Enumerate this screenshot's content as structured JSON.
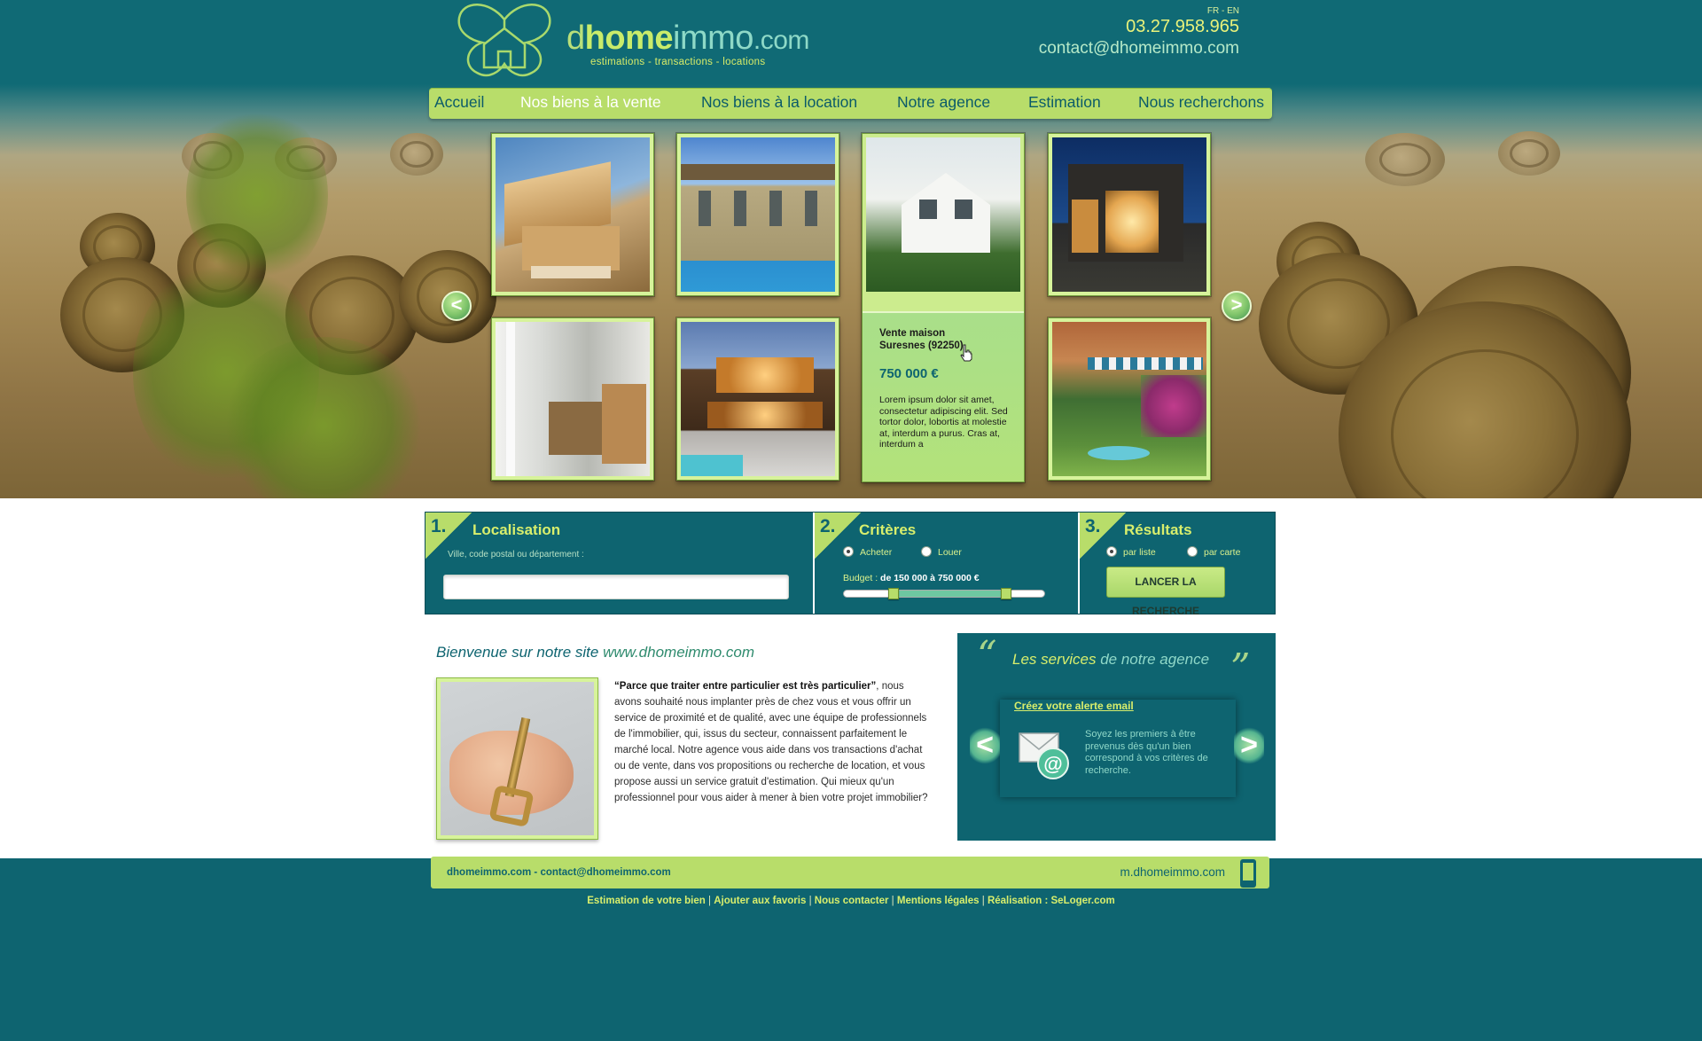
{
  "header": {
    "brand_d": "d",
    "brand_home": "home",
    "brand_immo": "immo",
    "brand_com": ".com",
    "tagline": "estimations - transactions - locations",
    "lang": "FR - EN",
    "phone": "03.27.958.965",
    "email": "contact@dhomeimmo.com"
  },
  "nav": {
    "items": [
      "Accueil",
      "Nos biens à la vente",
      "Nos biens à la location",
      "Notre agence",
      "Estimation",
      "Nous recherchons"
    ],
    "active_index": 1
  },
  "carousel": {
    "prev": "<",
    "next": ">",
    "featured": {
      "title": "Vente maison Suresnes (92250)",
      "price": "750 000 €",
      "description": "Lorem ipsum dolor sit amet, consectetur adipiscing elit. Sed tortor dolor, lobortis at molestie at, interdum a purus. Cras at, interdum a"
    }
  },
  "search": {
    "step1": {
      "num": "1.",
      "title": "Localisation",
      "hint": "Ville, code postal ou département :",
      "value": ""
    },
    "step2": {
      "num": "2.",
      "title": "Critères",
      "option_buy": "Acheter",
      "option_rent": "Louer",
      "selected": "Acheter",
      "budget_label": "Budget : ",
      "budget_value": "de 150 000 à 750 000 €",
      "budget_min": 150000,
      "budget_max": 750000
    },
    "step3": {
      "num": "3.",
      "title": "Résultats",
      "option_list": "par liste",
      "option_map": "par carte",
      "selected": "par liste",
      "button": "LANCER LA RECHERCHE"
    }
  },
  "welcome": {
    "title_prefix": "Bienvenue sur notre site ",
    "title_site": "www.dhomeimmo.com",
    "quote": "“Parce que traiter entre particulier est très particulier”",
    "body": "nous avons souhaité nous implanter près de chez vous et vous offrir un service de proximité et de qualité, avec une équipe de professionnels de l'immobilier, qui, issus du secteur, connaissent parfaitement le marché local. Notre agence vous aide dans vos transactions d'achat ou de vente, dans vos propositions ou recherche de location, et vous propose aussi un service gratuit d'estimation. Qui mieux qu'un professionnel pour vous aider à mener à bien votre projet immobilier?"
  },
  "services": {
    "title_lead": "Les services",
    "title_rest": " de notre agence",
    "open_quote": "“",
    "close_quote": "”",
    "link": "Créez votre alerte email",
    "text": "Soyez les premiers à être prevenus dès qu'un bien correspond à vos critères de recherche.",
    "prev": "<",
    "next": ">"
  },
  "footer": {
    "site": "dhomeimmo.com",
    "separator": " - ",
    "email": "contact@dhomeimmo.com",
    "mobile": "m.dhomeimmo.com",
    "links": [
      "Estimation de votre bien",
      "Ajouter aux favoris",
      "Nous contacter",
      "Mentions légales",
      "Réalisation : SeLoger.com"
    ]
  },
  "colors": {
    "primary_teal": "#0e6470",
    "accent_lime": "#b8dd6a",
    "accent_yellow": "#d8ee6c"
  }
}
